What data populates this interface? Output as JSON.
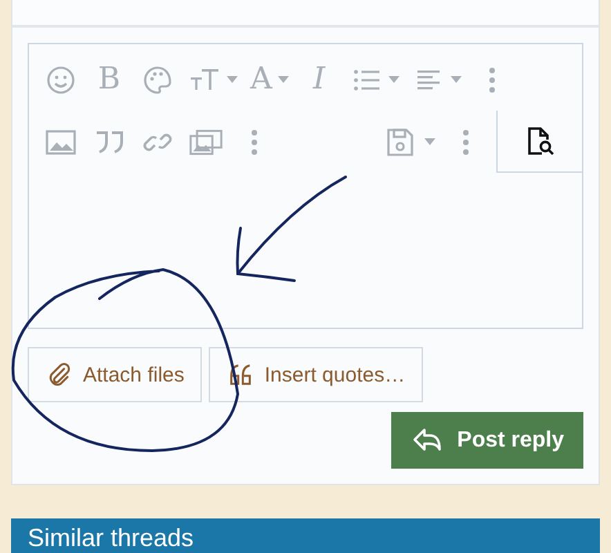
{
  "editor": {
    "toolbar_rows": [
      [
        {
          "kind": "emoji",
          "disabled": true
        },
        {
          "kind": "letter",
          "label": "B",
          "disabled": true
        },
        {
          "kind": "palette",
          "disabled": true
        },
        {
          "kind": "font-size",
          "dropdown": true,
          "disabled": true
        },
        {
          "kind": "letter",
          "label": "A",
          "dropdown": true,
          "disabled": true
        },
        {
          "kind": "italic",
          "label": "I",
          "disabled": true
        },
        {
          "kind": "list",
          "dropdown": true,
          "disabled": true
        },
        {
          "kind": "align",
          "dropdown": true,
          "disabled": true
        },
        {
          "kind": "more",
          "disabled": true
        }
      ],
      [
        {
          "kind": "image",
          "disabled": true
        },
        {
          "kind": "quote",
          "disabled": true
        },
        {
          "kind": "link",
          "disabled": true
        },
        {
          "kind": "media",
          "disabled": true
        },
        {
          "kind": "more",
          "disabled": true
        },
        {
          "kind": "spacer"
        },
        {
          "kind": "save",
          "dropdown": true,
          "disabled": true
        },
        {
          "kind": "more",
          "disabled": true
        }
      ]
    ],
    "preview": {
      "disabled": false
    }
  },
  "actions": [
    {
      "kind": "attach",
      "label": "Attach files"
    },
    {
      "kind": "quotes",
      "label": "Insert quotes…"
    }
  ],
  "submit": {
    "label": "Post reply"
  },
  "similar_threads": {
    "title": "Similar threads"
  },
  "annotations": {
    "arrow": true,
    "circle": true
  }
}
